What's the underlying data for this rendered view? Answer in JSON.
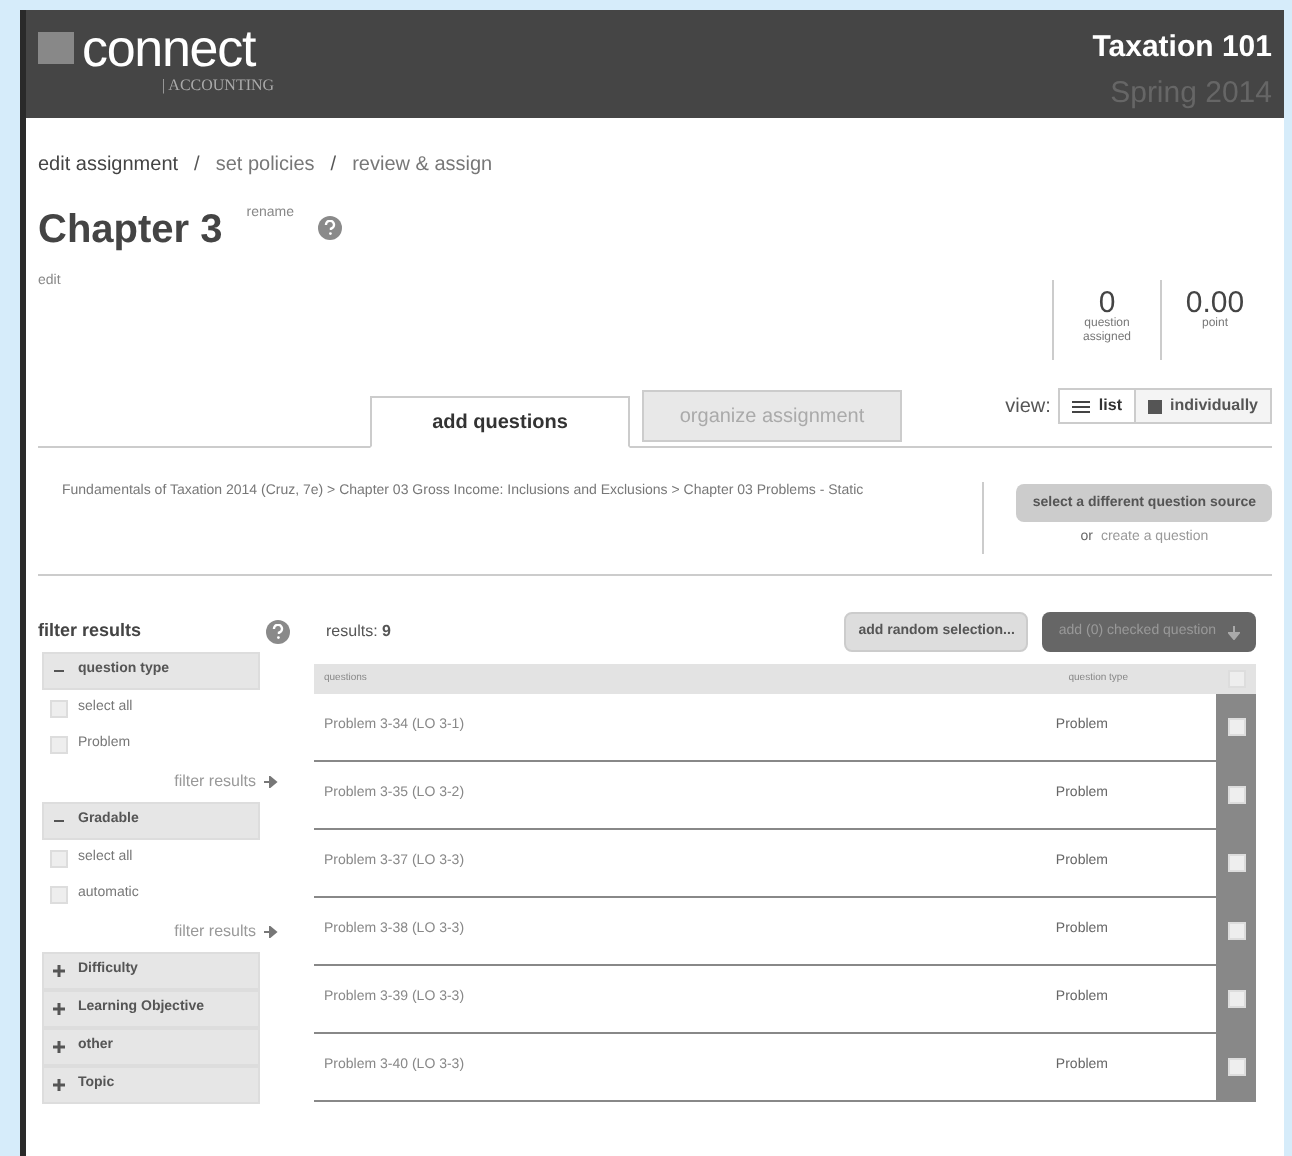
{
  "header": {
    "brand": "connect",
    "sub_brand": "| ACCOUNTING",
    "course": "Taxation 101",
    "term": "Spring 2014"
  },
  "steps": [
    {
      "label": "edit assignment",
      "selected": true
    },
    {
      "label": "set policies",
      "selected": false
    },
    {
      "label": "review & assign",
      "selected": false
    }
  ],
  "separator": "/",
  "title": "Chapter 3",
  "rename": "rename",
  "edit": "edit",
  "counters": [
    {
      "value": "0",
      "label": "question assigned"
    },
    {
      "value": "0.00",
      "label": "point"
    }
  ],
  "tabs": [
    {
      "label": "add questions",
      "selected": true
    },
    {
      "label": "organize assignment",
      "selected": false
    }
  ],
  "view": {
    "label": "view:",
    "options": [
      {
        "label": "list",
        "selected": true
      },
      {
        "label": "individually",
        "selected": false
      }
    ]
  },
  "source": {
    "path": [
      "Fundamentals of Taxation 2014 (Cruz, 7e)",
      "Chapter 03 Gross Income: Inclusions and Exclusions",
      "Chapter 03 Problems - Static"
    ],
    "path_sep": ">",
    "button": "select a different question source",
    "or": "or",
    "create": "create a question"
  },
  "filters": {
    "title": "filter results",
    "groups": [
      {
        "label": "question type",
        "expanded": true,
        "options": [
          {
            "label": "select all",
            "checked": false
          },
          {
            "label": "Problem",
            "checked": false
          }
        ],
        "apply": "filter results"
      },
      {
        "label": "Gradable",
        "expanded": true,
        "options": [
          {
            "label": "select all",
            "checked": false
          },
          {
            "label": "automatic",
            "checked": false
          }
        ],
        "apply": "filter results"
      },
      {
        "label": "Difficulty",
        "expanded": false
      },
      {
        "label": "Learning Objective",
        "expanded": false
      },
      {
        "label": "other",
        "expanded": false
      },
      {
        "label": "Topic",
        "expanded": false
      }
    ]
  },
  "results": {
    "label": "results:",
    "count": "9",
    "random_button": "add random selection...",
    "add_button": "add (0) checked question",
    "columns": [
      "questions",
      "question type"
    ],
    "select_all_checked": false,
    "rows": [
      {
        "question": "Problem 3-34 (LO 3-1)",
        "type": "Problem",
        "checked": false
      },
      {
        "question": "Problem 3-35 (LO 3-2)",
        "type": "Problem",
        "checked": false
      },
      {
        "question": "Problem 3-37 (LO 3-3)",
        "type": "Problem",
        "checked": false
      },
      {
        "question": "Problem 3-38 (LO 3-3)",
        "type": "Problem",
        "checked": false
      },
      {
        "question": "Problem 3-39 (LO 3-3)",
        "type": "Problem",
        "checked": false
      },
      {
        "question": "Problem 3-40 (LO 3-3)",
        "type": "Problem",
        "checked": false
      }
    ]
  }
}
